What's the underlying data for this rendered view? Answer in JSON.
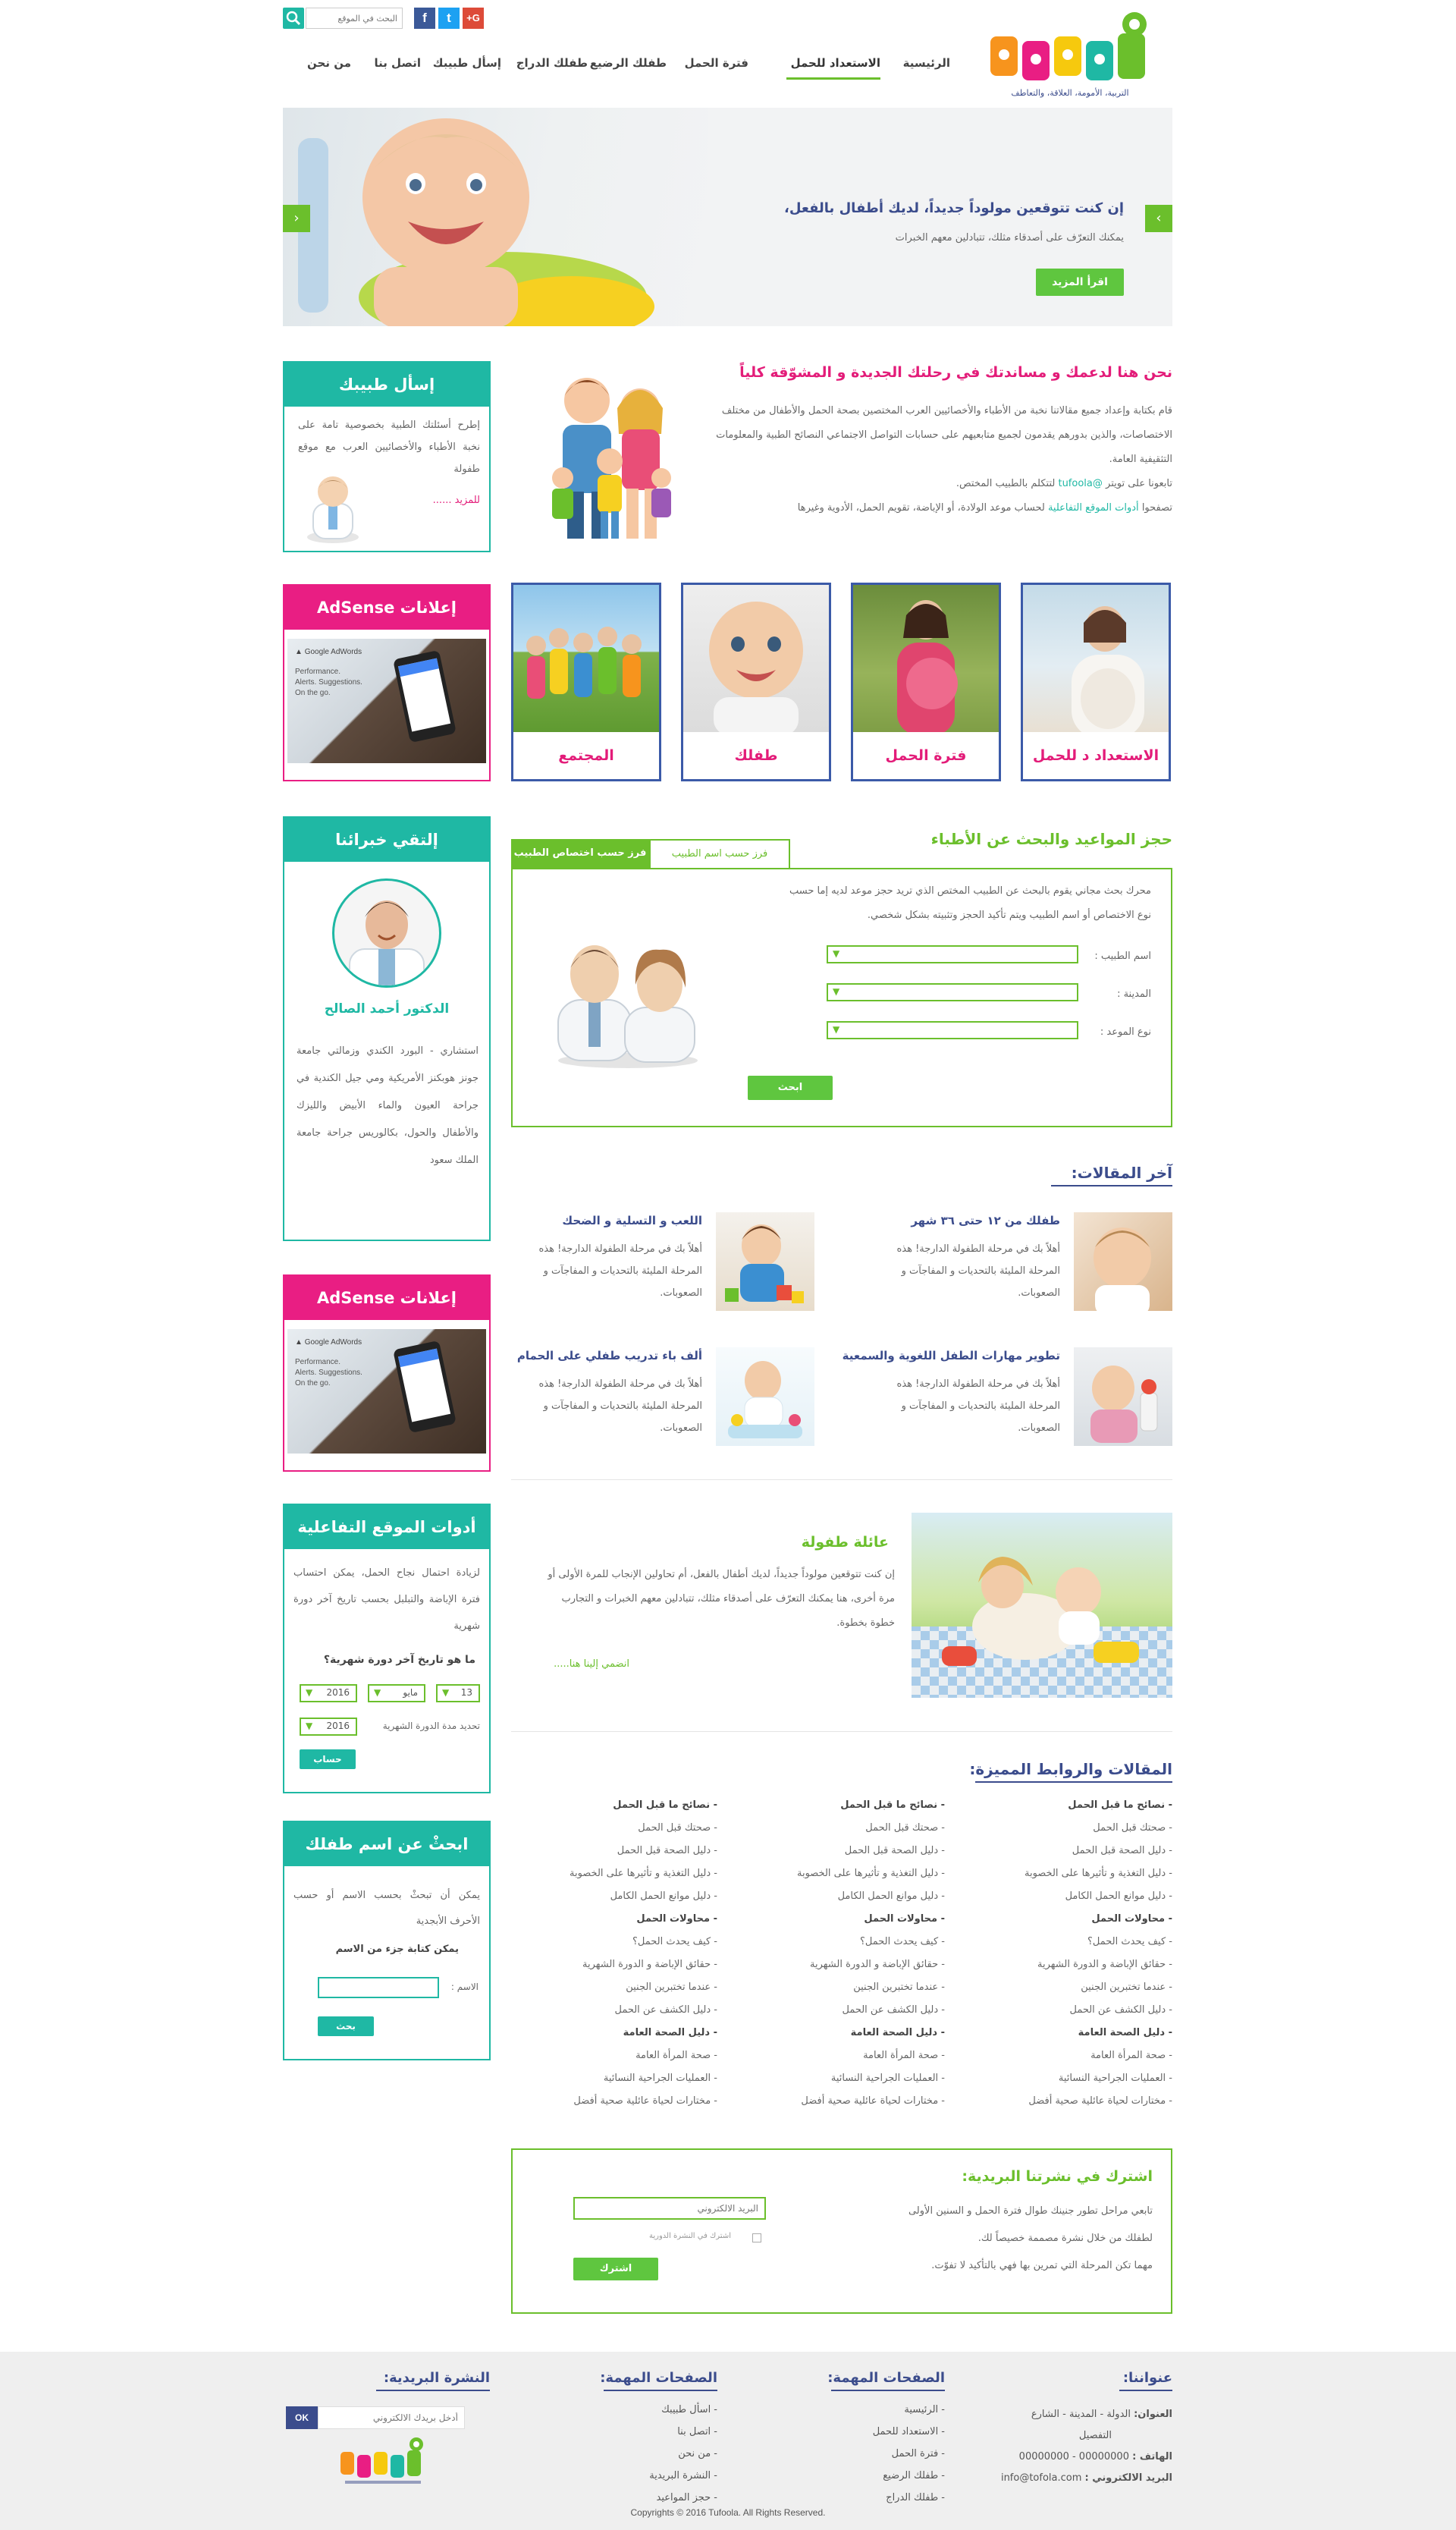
{
  "header": {
    "search_placeholder": "البحث في الموقع",
    "social": [
      "f",
      "t",
      "G+"
    ],
    "logo_tagline": "التربية، الأمومة، العلاقة، والتعاطف",
    "nav": [
      {
        "label": "الرئيسية"
      },
      {
        "label": "الاستعداد للحمل",
        "active": true
      },
      {
        "label": "فترة الحمل"
      },
      {
        "label": "طفلك الرضيع"
      },
      {
        "label": "طفلك الدراج"
      },
      {
        "label": "إسأل طبيبك"
      },
      {
        "label": "اتصل بنا"
      },
      {
        "label": "من نحن"
      }
    ]
  },
  "hero": {
    "title": "إن كنت تتوقعين مولوداً جديداً، لديك أطفال بالفعل،",
    "text": "يمكنك التعرّف على أصدقاء مثلك، تتبادلين معهم الخبرات",
    "button": "اقرأ المزيد"
  },
  "intro": {
    "title": "نحن هنا لدعمك و مساندتك في رحلتك الجديدة و المشوّقة كلياً",
    "p1": "قام بكتابة وإعداد جميع مقالاتنا نخبة من الأطباء والأخصائيين العرب المختصين بصحة الحمل والأطفال من مختلف الاختصاصات، والذين بدورهم يقدمون لجميع متابعيهم على حسابات التواصل الاجتماعي النصائح الطبية والمعلومات التثقيفية العامة.",
    "p2_a": "تابعونا على تويتر",
    "p2_link": "tufoola@",
    "p2_b": "لتتكلم بالطبيب المختص.",
    "p3_a": "تصفحوا",
    "p3_link": "أدوات الموقع التفاعلية",
    "p3_b": "لحساب موعد الولادة، أو الإباضة، تقويم الحمل، الأدوية وغيرها"
  },
  "sidebar": {
    "ask": {
      "title": "إسأل طبيبك",
      "text": "إطرح أسئلتك الطبية بخصوصية تامة على نخبة الأطباء والأخصائيين العرب مع موقع طفولة",
      "more": "للمزيد ......"
    },
    "ad1": {
      "title": "إعلانات AdSense",
      "brand": "Google AdWords",
      "lines": [
        "Performance.",
        "Alerts. Suggestions.",
        "On the go."
      ]
    },
    "expert": {
      "title": "إلتقي خبرائنا",
      "name": "الدكتور أحمد الصالح",
      "bio": "استشاري - البورد الكندي وزمالتي جامعة جونز هوبكنز الأمريكية ومي جيل الكندية في جراحة العيون والماء الأبيض والليزك والأطفال والحول، بكالوريس جراحة جامعة الملك سعود"
    },
    "ad2": {
      "title": "إعلانات AdSense",
      "brand": "Google AdWords",
      "lines": [
        "Performance.",
        "Alerts. Suggestions.",
        "On the go."
      ]
    },
    "tools": {
      "title": "أدوات الموقع التفاعلية",
      "text": "لزيادة احتمال نجاح الحمل، يمكن احتساب فترة الإباضة والتبلبل بحسب تاريخ آخر دورة شهرية",
      "question": "ما هو تاريخ آخر دورة شهرية؟",
      "day": "13",
      "month": "مايو",
      "year": "2016",
      "cycle_label": "تحديد مدة الدورة الشهرية",
      "cycle_value": "2016",
      "button": "حساب"
    },
    "name": {
      "title": "ابحثْ عن اسم طفلك",
      "text": "يمكن أن تبحثْ بحسب الاسم أو حسب الأحرف الأبجدية",
      "bold": "يمكن كتابة جزء من الاسم",
      "label": "الاسم :",
      "button": "بحث"
    }
  },
  "categories": [
    {
      "label": "الاستعداد د للحمل"
    },
    {
      "label": "فترة الحمل"
    },
    {
      "label": "طفلك"
    },
    {
      "label": "المجتمع"
    }
  ],
  "booking": {
    "title": "حجز المواعيد والبحث عن الأطباء",
    "tab_name": "فرز حسب اسم الطبيب",
    "tab_spec": "فرز حسب اختصاص الطبيب",
    "desc1": "محرك بحث مجاني يقوم بالبحث عن الطبيب المختص الذي تريد حجز موعد لديه إما حسب",
    "desc2": "نوع الاختصاص أو اسم الطبيب ويتم تأكيد الحجز وتثبيته بشكل شخصي.",
    "f_doctor": "اسم الطبيب :",
    "f_city": "المدينة :",
    "f_type": "نوع الموعد :",
    "button": "ابحث"
  },
  "latest": {
    "title": "آخر المقالات:",
    "items": [
      {
        "title": "طفلك من ١٢ حتى ٣٦ شهر",
        "text": "أهلاً بك في مرحلة الطفولة الدارجة! هذه المرحلة المليئة بالتحديات و المفاجآت و الصعوبات."
      },
      {
        "title": "اللعب و التسلية و الضحك",
        "text": "أهلاً بك في مرحلة الطفولة الدارجة! هذه المرحلة المليئة بالتحديات و المفاجآت و الصعوبات."
      },
      {
        "title": "تطوير مهارات الطفل اللغوية والسمعية",
        "text": "أهلاً بك في مرحلة الطفولة الدارجة! هذه المرحلة المليئة بالتحديات و المفاجآت و الصعوبات."
      },
      {
        "title": "ألف باء تدريب طفلي على الحمام",
        "text": "أهلاً بك في مرحلة الطفولة الدارجة! هذه المرحلة المليئة بالتحديات و المفاجآت و الصعوبات."
      }
    ]
  },
  "family": {
    "title": "عائلة طفولة",
    "text": "إن كنت تتوقعين مولوداً جديداً، لديك أطفال بالفعل، أم تحاولين الإنجاب للمرة الأولى أو مرة أخرى، هنا يمكنك التعرّف على أصدقاء مثلك، تتبادلين معهم الخبرات و التجارب خطوة بخطوة.",
    "link": "انضمي إلينا هنا....."
  },
  "links": {
    "title": "المقالات والروابط المميزة:",
    "items": [
      {
        "t": "- نصائح ما قبل الحمل",
        "h": true
      },
      {
        "t": "- صحتك قبل الحمل"
      },
      {
        "t": "- دليل الصحة قبل الحمل"
      },
      {
        "t": "- دليل التغذية و تأثيرها على الخصوبة"
      },
      {
        "t": "- دليل موانع الحمل الكامل"
      },
      {
        "t": "- محاولات الحمل",
        "h": true
      },
      {
        "t": "- كيف يحدث الحمل؟"
      },
      {
        "t": "- حقائق الإباضة و الدورة الشهرية"
      },
      {
        "t": "- عندما تختبرين الجنين"
      },
      {
        "t": "- دليل الكشف عن الحمل"
      },
      {
        "t": "- دليل الصحة العامة",
        "h": true
      },
      {
        "t": "- صحة المرأة العامة"
      },
      {
        "t": "- العمليات الجراحية النسائية"
      },
      {
        "t": "- مختارات لحياة عائلية صحية أفضل"
      }
    ]
  },
  "newsletter": {
    "title": "اشترك في نشرتنا البريدية:",
    "p1": "تابعي مراحل تطور جنينك طوال فترة الحمل و السنين الأولى",
    "p2": "لطفلك من خلال نشرة مصممة خصيصاً لك.",
    "p3": "مهما تكن المرحلة التي تمرين بها فهي بالتأكيد لا تفوّت.",
    "placeholder": "البريد الالكتروني",
    "check": "اشترك في النشرة الدورية",
    "button": "اشترك"
  },
  "footer": {
    "address_title": "عنواننا:",
    "addr_label": "العنوان:",
    "addr": "الدولة - المدينة - الشارع",
    "addr2": "التفصيل",
    "phone_label": "الهاتف :",
    "phone": "00000000 - 00000000",
    "email_label": "البريد الالكتروني :",
    "email": "info@tofola.com",
    "pages1_title": "الصفحات المهمة:",
    "pages1": [
      "- الرئيسية",
      "- الاستعداد للحمل",
      "- فترة الحمل",
      "- طفلك الرضيع",
      "- طفلك الدراج"
    ],
    "pages2_title": "الصفحات المهمة:",
    "pages2": [
      "- اسأل طبيبك",
      "- اتصل بنا",
      "- من نحن",
      "- النشرة البريدية",
      "- حجز المواعيد"
    ],
    "news_title": "النشرة البريدية:",
    "news_placeholder": "أدخل بريدك الالكتروني",
    "news_button": "OK",
    "copyright": "Copyrights © 2016 Tufoola. All Rights Reserved."
  },
  "colors": {
    "pink": "#e31c79",
    "green": "#6bbf2c",
    "navy": "#3b4c8c",
    "teal": "#1fb8a4"
  }
}
